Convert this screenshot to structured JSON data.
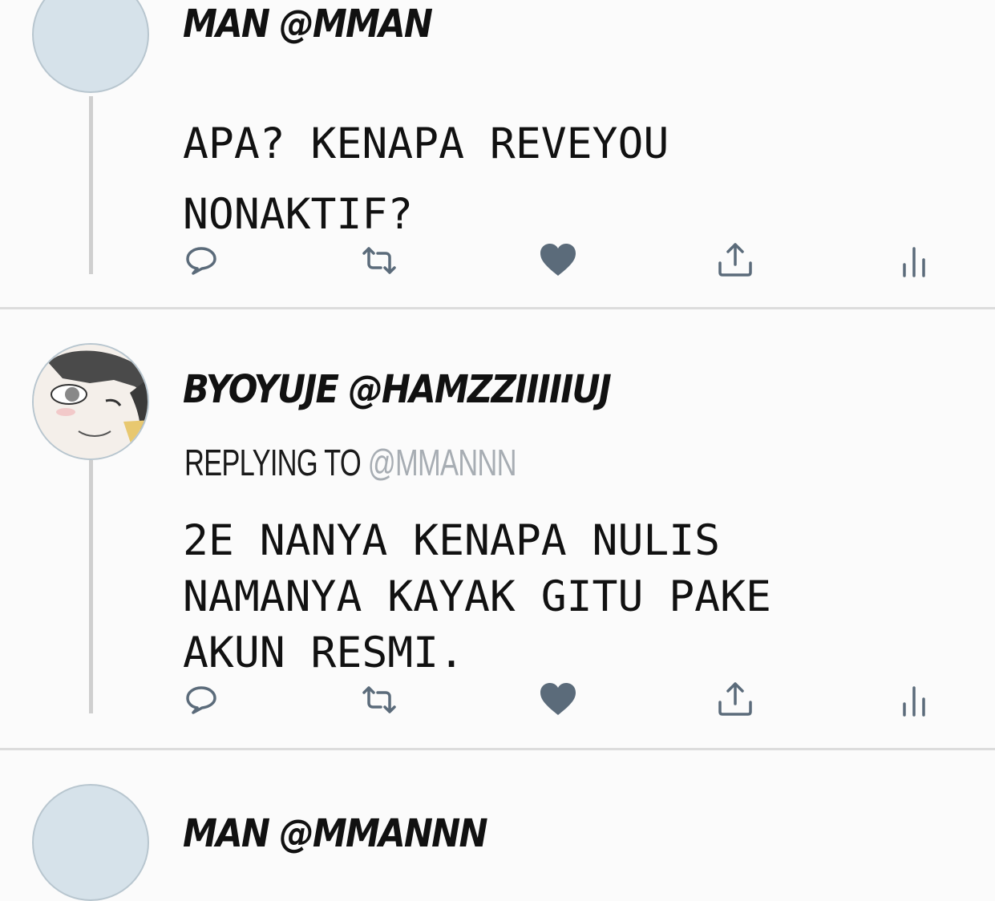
{
  "tweets": [
    {
      "name": "MAN @MMAN",
      "reply_prefix": "",
      "reply_handle": "",
      "text": "APA? KENAPA REVEYOU\nNONAKTIF?"
    },
    {
      "name": "BYOYUJE @HAMZZIIIIIUJ",
      "reply_prefix": "REPLYING TO ",
      "reply_handle": "@MMANNN",
      "text": "2E NANYA KENAPA NULIS\nNAMANYA KAYAK GITU PAKE\nAKUN RESMI."
    },
    {
      "name": "MAN @MMANNN",
      "reply_prefix": "",
      "reply_handle": "",
      "text": ""
    }
  ],
  "action_icons": [
    "reply-icon",
    "retweet-icon",
    "like-icon",
    "share-icon",
    "analytics-icon"
  ],
  "colors": {
    "icon": "#5b6b7a",
    "like": "#5b6b7a",
    "avatar_placeholder": "#d6e2ea",
    "reply_handle": "#a7adb3"
  }
}
